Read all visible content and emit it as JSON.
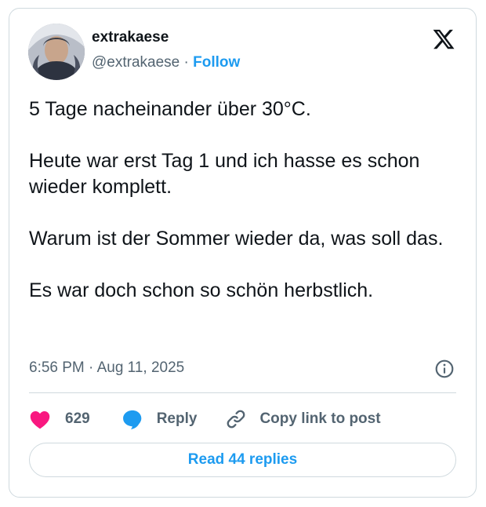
{
  "author": {
    "display_name": "extrakaese",
    "handle": "@extrakaese",
    "separator": "·",
    "follow_label": "Follow",
    "avatar_icon": "user-avatar"
  },
  "brand": {
    "logo_icon": "x-logo-icon",
    "color": "#0f1419"
  },
  "tweet": {
    "paragraphs": [
      "5 Tage nacheinander über 30°C.",
      "Heute war erst Tag 1 und ich hasse es schon wieder komplett.",
      "Warum ist der Sommer wieder da, was soll das.",
      "Es war doch schon so schön herbstlich."
    ],
    "timestamp": "6:56 PM · Aug 11, 2025"
  },
  "actions": {
    "like_count": "629",
    "like_icon": "heart-icon",
    "like_color": "#f91880",
    "reply_label": "Reply",
    "reply_icon": "speech-bubble-icon",
    "reply_color": "#1d9bf0",
    "copy_label": "Copy link to post",
    "copy_icon": "link-icon",
    "info_icon": "info-icon"
  },
  "footer": {
    "read_replies_label": "Read 44 replies",
    "accent_color": "#1d9bf0"
  }
}
